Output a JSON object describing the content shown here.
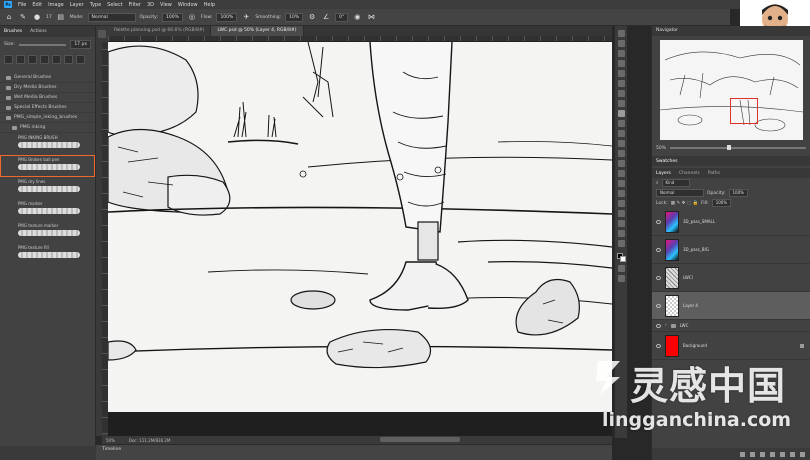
{
  "menu": [
    "File",
    "Edit",
    "Image",
    "Layer",
    "Type",
    "Select",
    "Filter",
    "3D",
    "View",
    "Window",
    "Help"
  ],
  "options": {
    "mode_label": "Mode:",
    "mode_value": "Normal",
    "opacity_label": "Opacity:",
    "opacity_value": "100%",
    "flow_label": "Flow:",
    "flow_value": "100%",
    "smoothing_label": "Smoothing:",
    "smoothing_value": "10%",
    "angle_value": "0°",
    "size_value": "17"
  },
  "brushes_panel": {
    "tabs": [
      "Brushes",
      "Actions"
    ],
    "size_label": "Size:",
    "size_value": "17 px",
    "folders": [
      "General Brushes",
      "Dry Media Brushes",
      "Wet Media Brushes",
      "Special Effects Brushes",
      "PMG_simple_inking_brushes",
      "PMG inking"
    ],
    "brushes": [
      {
        "name": "PMG INKING BRUSH",
        "selected": false
      },
      {
        "name": "PMG Broken ball pen",
        "selected": true
      },
      {
        "name": "PMG dry lines",
        "selected": false
      },
      {
        "name": "PMG marker",
        "selected": false
      },
      {
        "name": "PMG texture marker",
        "selected": false
      },
      {
        "name": "PMG texture fill",
        "selected": false
      }
    ]
  },
  "doc_tabs": [
    {
      "label": "Palette planning.psd @ 66.6% (RGB/8#)",
      "active": false
    },
    {
      "label": "LWC.psd @ 50% (Layer 4, RGB/8#)",
      "active": true
    }
  ],
  "status": {
    "zoom": "50%",
    "doc": "Doc: 111.2M/836.2M"
  },
  "timeline_label": "Timeline",
  "navigator": {
    "title": "Navigator",
    "zoom": "50%"
  },
  "swatches_tab": "Swatches",
  "layers": {
    "tabs": [
      "Layers",
      "Channels",
      "Paths"
    ],
    "kind_label": "Kind",
    "blend_mode": "Normal",
    "opacity_label": "Opacity:",
    "opacity_value": "100%",
    "lock_label": "Lock:",
    "fill_label": "Fill:",
    "fill_value": "100%",
    "items": [
      {
        "name": "3D_pass_SMALL",
        "thumb": "#5a3fb0"
      },
      {
        "name": "3D_pass_BIG",
        "thumb": "#5a3fb0"
      },
      {
        "name": "LWCl",
        "thumb": "#d8d8d8"
      },
      {
        "name": "Layer 4",
        "thumb": "#cfcfcf",
        "selected": true
      },
      {
        "name": "LWC",
        "thumb": "folder"
      },
      {
        "name": "Background",
        "thumb": "#ff0000"
      }
    ]
  },
  "watermark": {
    "cn": "灵感中国",
    "en": "lingganchina.com"
  },
  "colors": {
    "accent": "#31a8ff",
    "selected_outline": "#ef6a2a",
    "nav_rect": "#e2312b",
    "bg_layer": "#ff0000"
  }
}
